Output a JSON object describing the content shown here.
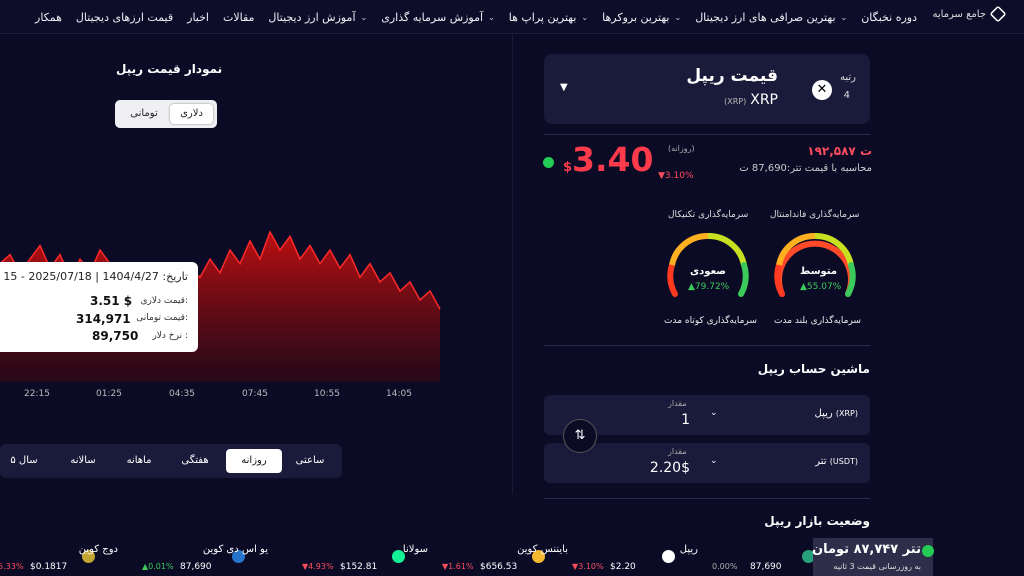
{
  "nav": {
    "items": [
      {
        "label": "دوره نخبگان",
        "caret": false
      },
      {
        "label": "بهترین صرافی های ارز دیجیتال",
        "caret": true
      },
      {
        "label": "بهترین بروکرها",
        "caret": true
      },
      {
        "label": "بهترین پراپ ها",
        "caret": true
      },
      {
        "label": "آموزش سرمایه گذاری",
        "caret": true
      },
      {
        "label": "آموزش ارز دیجیتال",
        "caret": true
      },
      {
        "label": "مقالات",
        "caret": false
      },
      {
        "label": "اخبار",
        "caret": false
      },
      {
        "label": "قیمت ارزهای دیجیتال",
        "caret": false
      },
      {
        "label": "همکار",
        "caret": false
      }
    ]
  },
  "coin": {
    "rank_label": "رتبه",
    "rank": "4",
    "name": "قیمت ریپل",
    "symbol": "XRP",
    "symbol_paren": "(XRP)",
    "toman_price": "۱۹۲,۵۸۷ ت",
    "usd_note": "محاسبه با قیمت تتر:87,690 ت",
    "price": "3.40",
    "currency": "$",
    "daily_label": "(روزانه)",
    "daily_change": "▼3.10%"
  },
  "gauges": [
    {
      "title": "سرمایه‌گذاری فاندامنتال",
      "value": "متوسط",
      "pct": "▲55.07%",
      "sub": "سرمایه‌گذاری بلند مدت"
    },
    {
      "title": "سرمایه‌گذاری تکنیکال",
      "value": "صعودی",
      "pct": "▲79.72%",
      "sub": "سرمایه‌گذاری کوتاه مدت"
    }
  ],
  "calculator": {
    "title": "ماشین حساب ریپل",
    "from": {
      "coin": "ریپل",
      "code": "(XRP)",
      "label": "مقدار",
      "value": "1"
    },
    "to": {
      "coin": "تتر",
      "code": "(USDT)",
      "label": "مقدار",
      "value": "2.20$"
    },
    "swap_icon": "swap-arrows-icon"
  },
  "market_title": "وضعیت بازار ریپل",
  "chart": {
    "title": "نمودار قیمت ریپل",
    "toggle": [
      "دلاری",
      "تومانی"
    ],
    "active_toggle": "دلاری",
    "xticks": [
      "22:15",
      "01:25",
      "04:35",
      "07:45",
      "10:55",
      "14:05"
    ],
    "tooltip": {
      "date": "تاریخ: 1404/4/27 | 2025/07/18 - 15",
      "rows": [
        {
          "label": "قیمت دلاری:",
          "value": "3.51 $"
        },
        {
          "label": "قیمت تومانی:",
          "value": "314,971"
        },
        {
          "label": "نرخ دلار :",
          "value": "89,750"
        }
      ]
    },
    "ranges": [
      "ساعتی",
      "روزانه",
      "هفتگی",
      "ماهانه",
      "سالانه",
      "۵ سال"
    ],
    "active_range": "روزانه"
  },
  "chart_data": {
    "type": "area",
    "title": "نمودار قیمت ریپل",
    "xlabel": "",
    "ylabel": "",
    "categories": [
      "22:15",
      "01:25",
      "04:35",
      "07:45",
      "10:55",
      "14:05"
    ],
    "series": [
      {
        "values": [
          3.46,
          3.48,
          3.44,
          3.47,
          3.5,
          3.45,
          3.48,
          3.43,
          3.47,
          3.44,
          3.49,
          3.46,
          3.41,
          3.45,
          3.42,
          3.44,
          3.4,
          3.43,
          3.41,
          3.45,
          3.43,
          3.47,
          3.44,
          3.49,
          3.46,
          3.51,
          3.47,
          3.53,
          3.49,
          3.52,
          3.47,
          3.5,
          3.46,
          3.49,
          3.45,
          3.48,
          3.43,
          3.46,
          3.42,
          3.44,
          3.4,
          3.42,
          3.38,
          3.4,
          3.36
        ]
      }
    ],
    "ylim": [
      3.2,
      3.6
    ],
    "grid": false,
    "color": "#d81818"
  },
  "ticker": {
    "usdt_main": "تتر ۸۷,۷۴۷ تومان",
    "usdt_sub": "به روزرسانی قیمت 3 ثانیه",
    "items": [
      {
        "name": "تتر",
        "price": "87,690",
        "chg": "0.00%",
        "dir": "flat",
        "icon": "usdt-icon",
        "color": "#26a17b"
      },
      {
        "name": "ریپل",
        "price": "$2.20",
        "chg": "▼3.10%",
        "dir": "down",
        "icon": "xrp-icon",
        "color": "#ffffff"
      },
      {
        "name": "بایننس کوین",
        "price": "$656.53",
        "chg": "▼1.61%",
        "dir": "down",
        "icon": "bnb-icon",
        "color": "#f3ba2f"
      },
      {
        "name": "سولانا",
        "price": "$152.81",
        "chg": "▼4.93%",
        "dir": "down",
        "icon": "sol-icon",
        "color": "#14f195"
      },
      {
        "name": "یو اس دی کوین",
        "price": "87,690",
        "chg": "▲0.01%",
        "dir": "up",
        "icon": "usdc-icon",
        "color": "#2775ca"
      },
      {
        "name": "دوج کوین",
        "price": "$0.1817",
        "chg": "▼5.33%",
        "dir": "down",
        "icon": "doge-icon",
        "color": "#c2a633"
      }
    ]
  },
  "colors": {
    "accent_red": "#ff3b4b",
    "accent_green": "#3ccb5a",
    "bg": "#0b0b26",
    "card": "#1a1a3a"
  }
}
